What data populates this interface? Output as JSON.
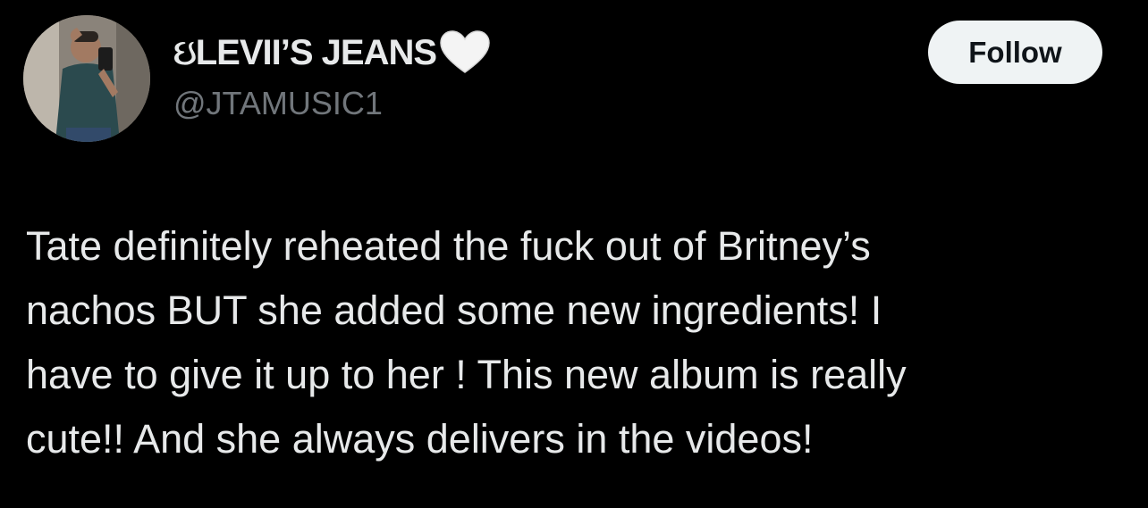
{
  "user": {
    "display_name_prefix": "ઇ",
    "display_name": "LEVII’S JEANS",
    "handle": "@JTAMUSIC1",
    "heart_icon": "white-heart-icon",
    "avatar_icon": "profile-photo"
  },
  "follow_button": {
    "label": "Follow"
  },
  "tweet": {
    "lines": [
      "Tate definitely reheated the fuck out of Britney’s",
      "nachos BUT she added some new ingredients! I",
      "have to give it up to her ! This new album is really",
      "cute!! And she always delivers in the videos!"
    ]
  },
  "colors": {
    "background": "#000000",
    "text_primary": "#e7e9ea",
    "text_secondary": "#71767b",
    "button_bg": "#eff3f4",
    "button_text": "#0f1419"
  }
}
